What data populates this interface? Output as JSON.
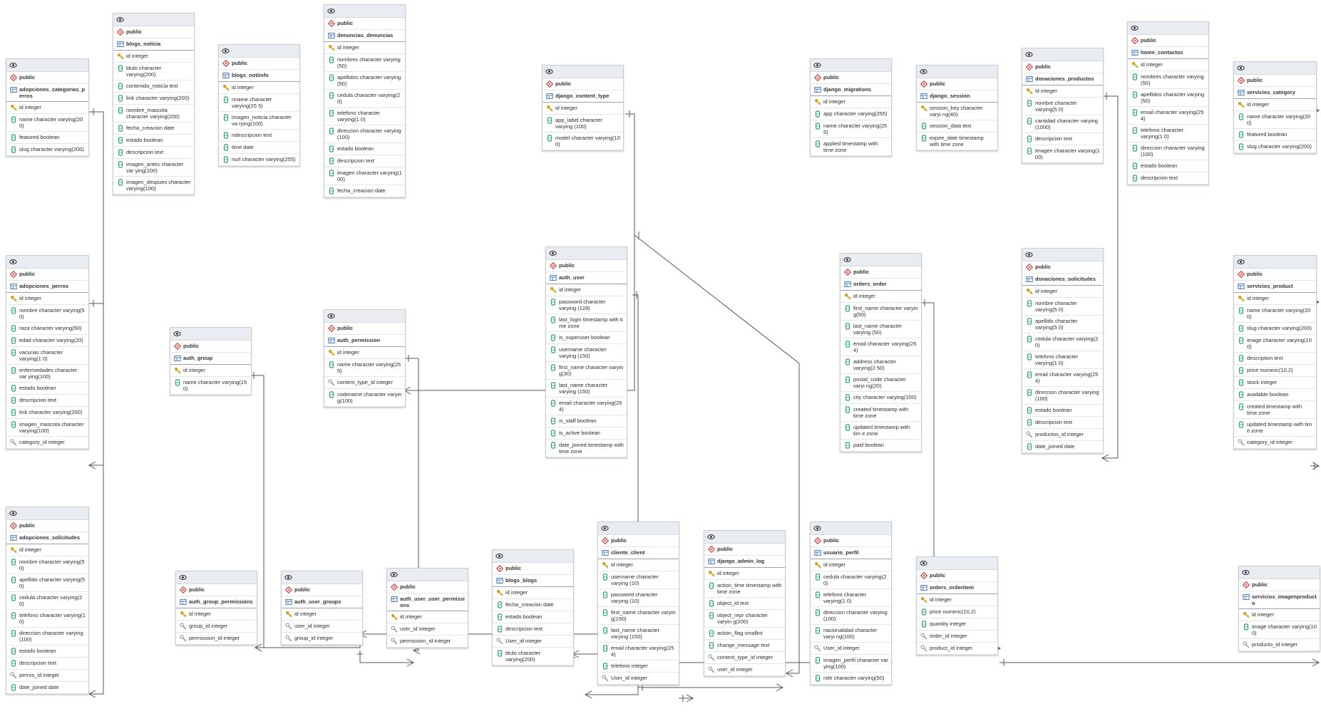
{
  "colors": {
    "schema_icon": "#d9534f",
    "table_icon": "#4a7fc1",
    "pk_icon": "#d4a017",
    "column_icon": "#2fa37a",
    "fk_icon": "#9aa0a6",
    "header_bg": "#e9edf2",
    "line": "#555555"
  },
  "tables": [
    {
      "id": "adopciones_categorias_perros",
      "schema": "public",
      "name": "adopciones_categorias_p erros",
      "columns": [
        {
          "label": "id integer",
          "kind": "pk"
        },
        {
          "label": "name character varying(20 0)",
          "kind": "col"
        },
        {
          "label": "featured boolean",
          "kind": "col"
        },
        {
          "label": "slug character varying(200)",
          "kind": "col"
        }
      ]
    },
    {
      "id": "blogs_noticia",
      "schema": "public",
      "name": "blogs_noticia",
      "columns": [
        {
          "label": "id integer",
          "kind": "pk"
        },
        {
          "label": "titulo character varying(200)",
          "kind": "col"
        },
        {
          "label": "contenido_noticia text",
          "kind": "col"
        },
        {
          "label": "link character varying(200)",
          "kind": "col"
        },
        {
          "label": "nombre_mascota character varying(200)",
          "kind": "col"
        },
        {
          "label": "fecha_creacion date",
          "kind": "col"
        },
        {
          "label": "estado boolean",
          "kind": "col"
        },
        {
          "label": "descripcion text",
          "kind": "col"
        },
        {
          "label": "imagen_antes character var ying(100)",
          "kind": "col"
        },
        {
          "label": "imagen_despues character varying(100)",
          "kind": "col"
        }
      ]
    },
    {
      "id": "blogs_notiinfo",
      "schema": "public",
      "name": "blogs_notiinfo",
      "columns": [
        {
          "label": "id integer",
          "kind": "pk"
        },
        {
          "label": "nname character varying(25 5)",
          "kind": "col"
        },
        {
          "label": "imagen_noticia character va rying(100)",
          "kind": "col"
        },
        {
          "label": "ndescripcion text",
          "kind": "col"
        },
        {
          "label": "time date",
          "kind": "col"
        },
        {
          "label": "nurl character varying(255)",
          "kind": "col"
        }
      ]
    },
    {
      "id": "denuncias_denuncias",
      "schema": "public",
      "name": "denuncias_denuncias",
      "columns": [
        {
          "label": "id integer",
          "kind": "pk"
        },
        {
          "label": "nombres character varying (50)",
          "kind": "col"
        },
        {
          "label": "apellidos character varying (50)",
          "kind": "col"
        },
        {
          "label": "cedula character varying(2 0)",
          "kind": "col"
        },
        {
          "label": "telefono character varying(1 0)",
          "kind": "col"
        },
        {
          "label": "direccion character varying (100)",
          "kind": "col"
        },
        {
          "label": "estado boolean",
          "kind": "col"
        },
        {
          "label": "descripcion text",
          "kind": "col"
        },
        {
          "label": "imagen character varying(1 00)",
          "kind": "col"
        },
        {
          "label": "fecha_creacion date",
          "kind": "col"
        }
      ]
    },
    {
      "id": "django_content_type",
      "schema": "public",
      "name": "django_content_type",
      "columns": [
        {
          "label": "id integer",
          "kind": "pk"
        },
        {
          "label": "app_label character varying (100)",
          "kind": "col"
        },
        {
          "label": "model character varying(10 0)",
          "kind": "col"
        }
      ]
    },
    {
      "id": "django_migrations",
      "schema": "public",
      "name": "django_migrations",
      "columns": [
        {
          "label": "id integer",
          "kind": "pk"
        },
        {
          "label": "app character varying(255)",
          "kind": "col"
        },
        {
          "label": "name character varying(25 5)",
          "kind": "col"
        },
        {
          "label": "applied timestamp with time zone",
          "kind": "col"
        }
      ]
    },
    {
      "id": "django_session",
      "schema": "public",
      "name": "django_session",
      "columns": [
        {
          "label": "session_key character varyi ng(40)",
          "kind": "pk"
        },
        {
          "label": "session_data text",
          "kind": "col"
        },
        {
          "label": "expire_date timestamp with time zone",
          "kind": "col"
        }
      ]
    },
    {
      "id": "donaciones_productos",
      "schema": "public",
      "name": "donaciones_productos",
      "columns": [
        {
          "label": "id integer",
          "kind": "pk"
        },
        {
          "label": "nombre character varying(5 0)",
          "kind": "col"
        },
        {
          "label": "cantidad character varying (1000)",
          "kind": "col"
        },
        {
          "label": "descripcion text",
          "kind": "col"
        },
        {
          "label": "imagen character varying(1 00)",
          "kind": "col"
        }
      ]
    },
    {
      "id": "home_contactos",
      "schema": "public",
      "name": "home_contactos",
      "columns": [
        {
          "label": "id integer",
          "kind": "pk"
        },
        {
          "label": "nombres character varying (50)",
          "kind": "col"
        },
        {
          "label": "apellidos character varying (50)",
          "kind": "col"
        },
        {
          "label": "email character varying(25 4)",
          "kind": "col"
        },
        {
          "label": "telefono character varying(1 0)",
          "kind": "col"
        },
        {
          "label": "direccion character varying (100)",
          "kind": "col"
        },
        {
          "label": "estado boolean",
          "kind": "col"
        },
        {
          "label": "descripcion text",
          "kind": "col"
        }
      ]
    },
    {
      "id": "servicios_category",
      "schema": "public",
      "name": "servicios_category",
      "columns": [
        {
          "label": "id integer",
          "kind": "pk"
        },
        {
          "label": "name character varying(20 0)",
          "kind": "col"
        },
        {
          "label": "featured boolean",
          "kind": "col"
        },
        {
          "label": "slug character varying(200)",
          "kind": "col"
        }
      ]
    },
    {
      "id": "adopciones_perros",
      "schema": "public",
      "name": "adopciones_perros",
      "columns": [
        {
          "label": "id integer",
          "kind": "pk"
        },
        {
          "label": "nombre character varying(5 0)",
          "kind": "col"
        },
        {
          "label": "raza character varying(50)",
          "kind": "col"
        },
        {
          "label": "edad character varying(20)",
          "kind": "col"
        },
        {
          "label": "vacunas character varying(1 0)",
          "kind": "col"
        },
        {
          "label": "enfermedades character var ying(100)",
          "kind": "col"
        },
        {
          "label": "estado boolean",
          "kind": "col"
        },
        {
          "label": "descripcion text",
          "kind": "col"
        },
        {
          "label": "link character varying(200)",
          "kind": "col"
        },
        {
          "label": "imagen_mascota character varying(100)",
          "kind": "col"
        },
        {
          "label": "category_id integer",
          "kind": "fk"
        }
      ]
    },
    {
      "id": "auth_user",
      "schema": "public",
      "name": "auth_user",
      "columns": [
        {
          "label": "id integer",
          "kind": "pk"
        },
        {
          "label": "password character varying (128)",
          "kind": "col"
        },
        {
          "label": "last_login timestamp with ti me zone",
          "kind": "col"
        },
        {
          "label": "is_superuser boolean",
          "kind": "col"
        },
        {
          "label": "username character varying (150)",
          "kind": "col"
        },
        {
          "label": "first_name character varyin g(30)",
          "kind": "col"
        },
        {
          "label": "last_name character varying (150)",
          "kind": "col"
        },
        {
          "label": "email character varying(25 4)",
          "kind": "col"
        },
        {
          "label": "is_staff boolean",
          "kind": "col"
        },
        {
          "label": "is_active boolean",
          "kind": "col"
        },
        {
          "label": "date_joined timestamp with time zone",
          "kind": "col"
        }
      ]
    },
    {
      "id": "orders_order",
      "schema": "public",
      "name": "orders_order",
      "columns": [
        {
          "label": "id integer",
          "kind": "pk"
        },
        {
          "label": "first_name character varyin g(50)",
          "kind": "col"
        },
        {
          "label": "last_name character varying (50)",
          "kind": "col"
        },
        {
          "label": "email character varying(25 4)",
          "kind": "col"
        },
        {
          "label": "address character varying(2 50)",
          "kind": "col"
        },
        {
          "label": "postal_code character varyi ng(20)",
          "kind": "col"
        },
        {
          "label": "city character varying(100)",
          "kind": "col"
        },
        {
          "label": "created timestamp with time zone",
          "kind": "col"
        },
        {
          "label": "updated timestamp with tim e zone",
          "kind": "col"
        },
        {
          "label": "paid boolean",
          "kind": "col"
        }
      ]
    },
    {
      "id": "donaciones_solicitudes",
      "schema": "public",
      "name": "donaciones_solicitudes",
      "columns": [
        {
          "label": "id integer",
          "kind": "pk"
        },
        {
          "label": "nombre character varying(5 0)",
          "kind": "col"
        },
        {
          "label": "apellido character varying(5 0)",
          "kind": "col"
        },
        {
          "label": "cedula character varying(2 0)",
          "kind": "col"
        },
        {
          "label": "telefono character varying(1 0)",
          "kind": "col"
        },
        {
          "label": "email character varying(25 4)",
          "kind": "col"
        },
        {
          "label": "direccion character varying (100)",
          "kind": "col"
        },
        {
          "label": "estado boolean",
          "kind": "col"
        },
        {
          "label": "descripcion text",
          "kind": "col"
        },
        {
          "label": "productos_id integer",
          "kind": "fk"
        },
        {
          "label": "date_joined date",
          "kind": "col"
        }
      ]
    },
    {
      "id": "servicios_product",
      "schema": "public",
      "name": "servicios_product",
      "columns": [
        {
          "label": "id integer",
          "kind": "pk"
        },
        {
          "label": "name character varying(20 0)",
          "kind": "col"
        },
        {
          "label": "slug character varying(200)",
          "kind": "col"
        },
        {
          "label": "image character varying(10 0)",
          "kind": "col"
        },
        {
          "label": "description text",
          "kind": "col"
        },
        {
          "label": "price numeric(10,2)",
          "kind": "col"
        },
        {
          "label": "stock integer",
          "kind": "col"
        },
        {
          "label": "available boolean",
          "kind": "col"
        },
        {
          "label": "created timestamp with time zone",
          "kind": "col"
        },
        {
          "label": "updated timestamp with tim e zone",
          "kind": "col"
        },
        {
          "label": "category_id integer",
          "kind": "fk"
        }
      ]
    },
    {
      "id": "auth_group",
      "schema": "public",
      "name": "auth_group",
      "columns": [
        {
          "label": "id integer",
          "kind": "pk"
        },
        {
          "label": "name character varying(15 0)",
          "kind": "col"
        }
      ]
    },
    {
      "id": "auth_permission",
      "schema": "public",
      "name": "auth_permission",
      "columns": [
        {
          "label": "id integer",
          "kind": "pk"
        },
        {
          "label": "name character varying(25 5)",
          "kind": "col"
        },
        {
          "label": "content_type_id integer",
          "kind": "fk"
        },
        {
          "label": "codename character varyin g(100)",
          "kind": "col"
        }
      ]
    },
    {
      "id": "adopciones_solicitudes",
      "schema": "public",
      "name": "adopciones_solicitudes",
      "columns": [
        {
          "label": "id integer",
          "kind": "pk"
        },
        {
          "label": "nombre character varying(5 0)",
          "kind": "col"
        },
        {
          "label": "apellido character varying(5 0)",
          "kind": "col"
        },
        {
          "label": "cedula character varying(2 0)",
          "kind": "col"
        },
        {
          "label": "telefono character varying(1 0)",
          "kind": "col"
        },
        {
          "label": "direccion character varying (100)",
          "kind": "col"
        },
        {
          "label": "estado boolean",
          "kind": "col"
        },
        {
          "label": "descripcion text",
          "kind": "col"
        },
        {
          "label": "perros_id integer",
          "kind": "fk"
        },
        {
          "label": "date_joined date",
          "kind": "col"
        }
      ]
    },
    {
      "id": "auth_group_permissions",
      "schema": "public",
      "name": "auth_group_permissions",
      "columns": [
        {
          "label": "id integer",
          "kind": "pk"
        },
        {
          "label": "group_id integer",
          "kind": "fk"
        },
        {
          "label": "permission_id integer",
          "kind": "fk"
        }
      ]
    },
    {
      "id": "auth_user_groups",
      "schema": "public",
      "name": "auth_user_groups",
      "columns": [
        {
          "label": "id integer",
          "kind": "pk"
        },
        {
          "label": "user_id integer",
          "kind": "fk"
        },
        {
          "label": "group_id integer",
          "kind": "fk"
        }
      ]
    },
    {
      "id": "auth_user_user_permissions",
      "schema": "public",
      "name": "auth_user_user_permissi ons",
      "columns": [
        {
          "label": "id integer",
          "kind": "pk"
        },
        {
          "label": "user_id integer",
          "kind": "fk"
        },
        {
          "label": "permission_id integer",
          "kind": "fk"
        }
      ]
    },
    {
      "id": "blogs_blogs",
      "schema": "public",
      "name": "blogs_blogs",
      "columns": [
        {
          "label": "id integer",
          "kind": "pk"
        },
        {
          "label": "fecha_creacion date",
          "kind": "col"
        },
        {
          "label": "estado boolean",
          "kind": "col"
        },
        {
          "label": "descripcion text",
          "kind": "col"
        },
        {
          "label": "User_id integer",
          "kind": "fk"
        },
        {
          "label": "titulo character varying(200)",
          "kind": "col"
        }
      ]
    },
    {
      "id": "cliente_client",
      "schema": "public",
      "name": "cliente_client",
      "columns": [
        {
          "label": "id integer",
          "kind": "pk"
        },
        {
          "label": "username character varying (10)",
          "kind": "col"
        },
        {
          "label": "password character varying (10)",
          "kind": "col"
        },
        {
          "label": "first_name character varyin g(150)",
          "kind": "col"
        },
        {
          "label": "last_name character varying (150)",
          "kind": "col"
        },
        {
          "label": "email character varying(25 4)",
          "kind": "col"
        },
        {
          "label": "telefono integer",
          "kind": "col"
        },
        {
          "label": "User_id integer",
          "kind": "fk"
        }
      ]
    },
    {
      "id": "django_admin_log",
      "schema": "public",
      "name": "django_admin_log",
      "columns": [
        {
          "label": "id integer",
          "kind": "pk"
        },
        {
          "label": "action_time timestamp with time zone",
          "kind": "col"
        },
        {
          "label": "object_id text",
          "kind": "col"
        },
        {
          "label": "object_repr character varyin g(200)",
          "kind": "col"
        },
        {
          "label": "action_flag smallint",
          "kind": "col"
        },
        {
          "label": "change_message text",
          "kind": "col"
        },
        {
          "label": "content_type_id integer",
          "kind": "fk"
        },
        {
          "label": "user_id integer",
          "kind": "fk"
        }
      ]
    },
    {
      "id": "usuario_perfil",
      "schema": "public",
      "name": "usuario_perfil",
      "columns": [
        {
          "label": "id integer",
          "kind": "pk"
        },
        {
          "label": "cedula character varying(2 0)",
          "kind": "col"
        },
        {
          "label": "telefono character varying(1 0)",
          "kind": "col"
        },
        {
          "label": "direccion character varying (100)",
          "kind": "col"
        },
        {
          "label": "nacionalidad character varyi ng(100)",
          "kind": "col"
        },
        {
          "label": "User_id integer",
          "kind": "fk"
        },
        {
          "label": "imagen_perfil character var ying(100)",
          "kind": "col"
        },
        {
          "label": "role character varying(50)",
          "kind": "col"
        }
      ]
    },
    {
      "id": "orders_orderitem",
      "schema": "public",
      "name": "orders_orderitem",
      "columns": [
        {
          "label": "id integer",
          "kind": "pk"
        },
        {
          "label": "price numeric(10,2)",
          "kind": "col"
        },
        {
          "label": "quantity integer",
          "kind": "col"
        },
        {
          "label": "order_id integer",
          "kind": "fk"
        },
        {
          "label": "product_id integer",
          "kind": "fk"
        }
      ]
    },
    {
      "id": "servicios_imagenproducto",
      "schema": "public",
      "name": "servicios_imagenproduct o",
      "columns": [
        {
          "label": "id integer",
          "kind": "pk"
        },
        {
          "label": "image character varying(10 0)",
          "kind": "col"
        },
        {
          "label": "producto_id integer",
          "kind": "fk"
        }
      ]
    }
  ]
}
